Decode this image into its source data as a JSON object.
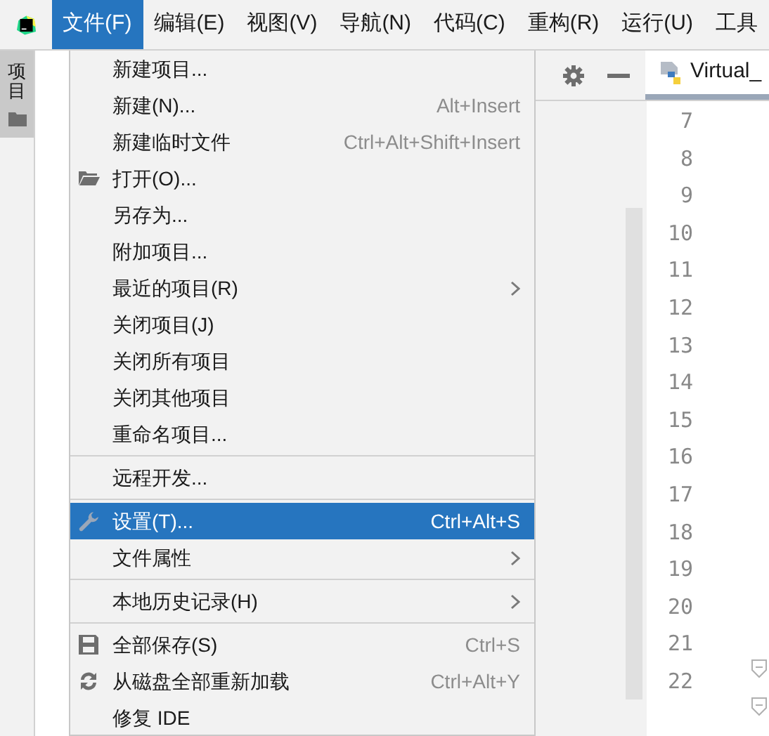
{
  "menu_bar": [
    {
      "label": "文件(F)",
      "selected": true
    },
    {
      "label": "编辑(E)",
      "selected": false
    },
    {
      "label": "视图(V)",
      "selected": false
    },
    {
      "label": "导航(N)",
      "selected": false
    },
    {
      "label": "代码(C)",
      "selected": false
    },
    {
      "label": "重构(R)",
      "selected": false
    },
    {
      "label": "运行(U)",
      "selected": false
    },
    {
      "label": "工具",
      "selected": false
    }
  ],
  "tool_window_bar": [
    {
      "label": "项目",
      "selected": true
    }
  ],
  "file_menu": [
    [
      {
        "label": "新建项目...",
        "selected": false,
        "submenu": false
      },
      {
        "label": "新建(N)...",
        "shortcut": "Alt+Insert",
        "selected": false,
        "submenu": false
      },
      {
        "label": "新建临时文件",
        "shortcut": "Ctrl+Alt+Shift+Insert",
        "selected": false,
        "submenu": false
      },
      {
        "label": "打开(O)...",
        "kind": "folder",
        "selected": false,
        "submenu": false
      },
      {
        "label": "另存为...",
        "selected": false,
        "submenu": false
      },
      {
        "label": "附加项目...",
        "selected": false,
        "submenu": false
      },
      {
        "label": "最近的项目(R)",
        "selected": false,
        "submenu": true
      },
      {
        "label": "关闭项目(J)",
        "selected": false,
        "submenu": false
      },
      {
        "label": "关闭所有项目",
        "selected": false,
        "submenu": false
      },
      {
        "label": "关闭其他项目",
        "selected": false,
        "submenu": false
      },
      {
        "label": "重命名项目...",
        "selected": false,
        "submenu": false
      }
    ],
    [
      {
        "label": "远程开发...",
        "selected": false,
        "submenu": false
      }
    ],
    [
      {
        "label": "设置(T)...",
        "shortcut": "Ctrl+Alt+S",
        "kind": "wrench",
        "selected": true,
        "submenu": false
      },
      {
        "label": "文件属性",
        "selected": false,
        "submenu": true
      }
    ],
    [
      {
        "label": "本地历史记录(H)",
        "selected": false,
        "submenu": true
      }
    ],
    [
      {
        "label": "全部保存(S)",
        "shortcut": "Ctrl+S",
        "kind": "save",
        "selected": false,
        "submenu": false
      },
      {
        "label": "从磁盘全部重新加载",
        "shortcut": "Ctrl+Alt+Y",
        "kind": "reload",
        "selected": false,
        "submenu": false
      },
      {
        "label": "修复 IDE",
        "selected": false,
        "submenu": false
      }
    ]
  ],
  "editor": {
    "tab": {
      "title": "Virtual_"
    },
    "line_numbers": [
      "7",
      "8",
      "9",
      "10",
      "11",
      "12",
      "13",
      "14",
      "15",
      "16",
      "17",
      "18",
      "19",
      "20",
      "21",
      "22"
    ]
  }
}
